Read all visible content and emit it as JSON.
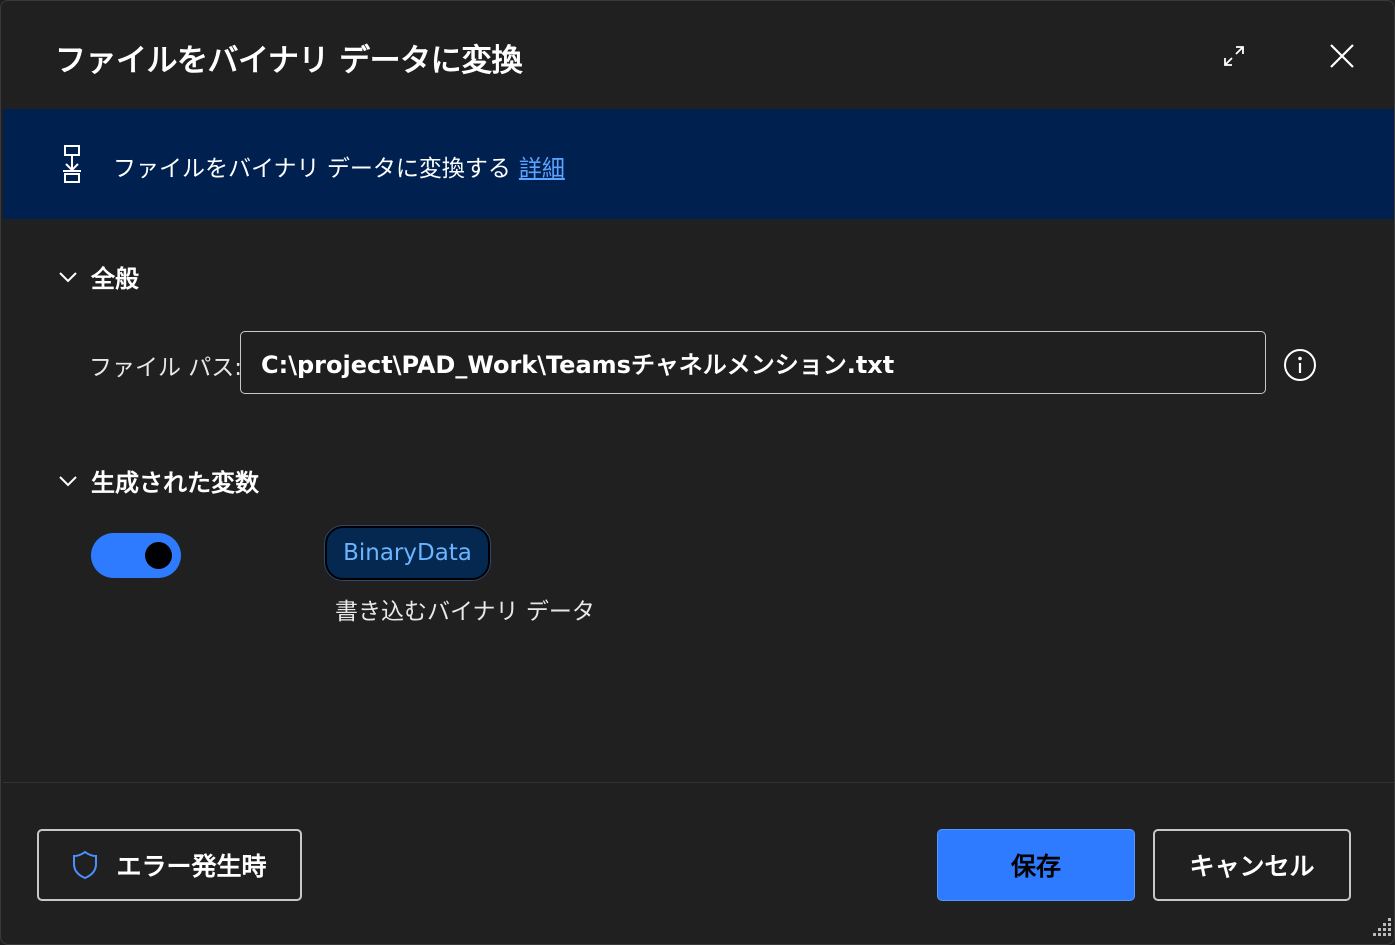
{
  "dialog": {
    "title": "ファイルをバイナリ データに変換",
    "expand_icon": "expand-diagonal-icon",
    "close_icon": "close-icon"
  },
  "banner": {
    "icon": "convert-binary-icon",
    "text": "ファイルをバイナリ データに変換する",
    "link": "詳細"
  },
  "general": {
    "header": "全般",
    "file_path_label": "ファイル パス:",
    "file_path_value": "C:\\project\\PAD_Work\\Teamsチャネルメンション.txt",
    "info_icon": "info-icon"
  },
  "variables": {
    "header": "生成された変数",
    "toggle_on": true,
    "variable_name": "BinaryData",
    "variable_description": "書き込むバイナリ データ"
  },
  "footer": {
    "on_error_label": "エラー発生時",
    "on_error_icon": "shield-icon",
    "save_label": "保存",
    "cancel_label": "キャンセル"
  },
  "colors": {
    "accent": "#2f7bff",
    "banner_bg": "#002050",
    "link": "#5ba3ff",
    "dialog_bg": "#202020"
  }
}
